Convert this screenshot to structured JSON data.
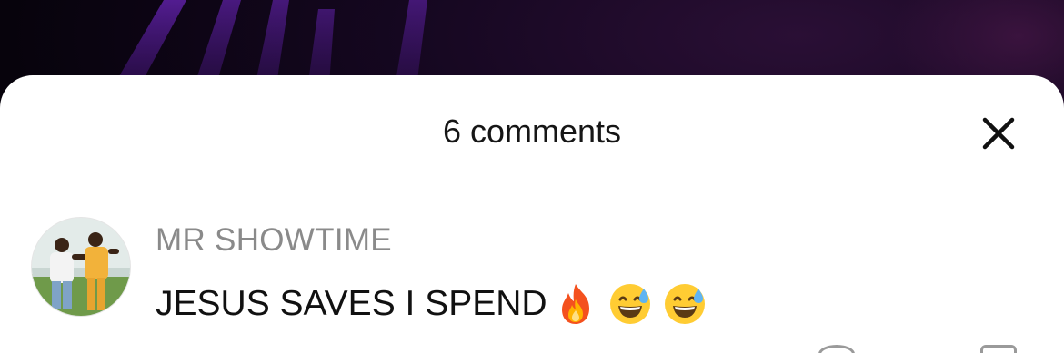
{
  "sheet": {
    "title": "6 comments",
    "close_icon": "close-icon"
  },
  "comments": [
    {
      "username": "MR SHOWTIME",
      "text": "JESUS SAVES I SPEND",
      "emojis": [
        "fire-emoji",
        "grinning-sweat-emoji",
        "grinning-sweat-emoji"
      ],
      "avatar": "user-avatar-photo"
    }
  ],
  "colors": {
    "sheet_background": "#ffffff",
    "title_text": "#161616",
    "username_text": "#8a8a8a",
    "comment_text": "#111111",
    "video_background": "#0b0410",
    "video_accent": "#5a1f9e"
  }
}
